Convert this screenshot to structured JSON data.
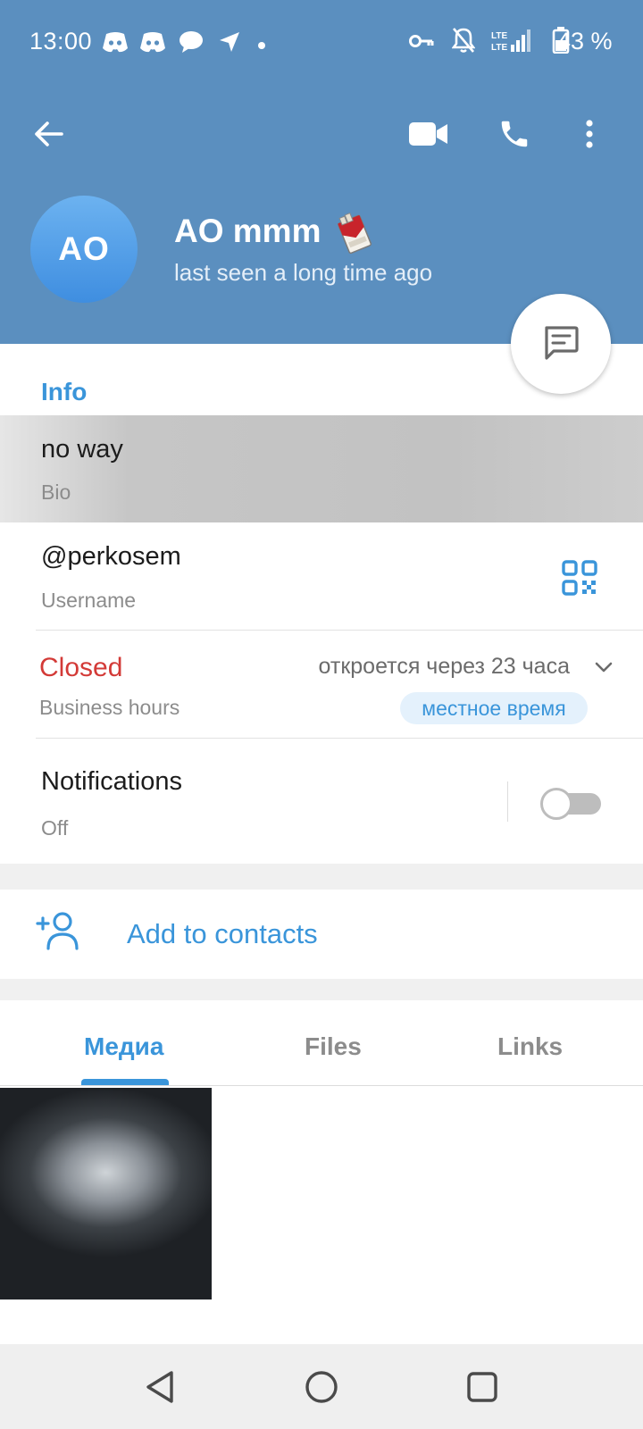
{
  "status_bar": {
    "time": "13:00",
    "battery_text": "43 %",
    "left_icons": [
      "discord-icon",
      "discord-icon",
      "chat-bubble-icon",
      "location-arrow-icon",
      "dot-icon"
    ],
    "right_icons": [
      "vpn-key-icon",
      "mute-icon",
      "lte-signal-icon",
      "battery-icon"
    ]
  },
  "toolbar": {
    "back_icon": "arrow-left-icon",
    "video_icon": "video-call-icon",
    "call_icon": "phone-icon",
    "more_icon": "more-vert-icon"
  },
  "profile": {
    "avatar_initials": "AO",
    "name": "AO mmm",
    "name_emoji": "cigarette-pack-emoji",
    "last_seen": "last seen a long time ago",
    "fab_icon": "message-icon"
  },
  "info": {
    "title": "Info",
    "bio": {
      "value": "no way",
      "label": "Bio"
    },
    "username": {
      "value": "@perkosem",
      "label": "Username",
      "icon": "qr-code-icon"
    },
    "business_hours": {
      "status": "Closed",
      "label": "Business hours",
      "opens_text": "откроется через 23 часа",
      "local_time_badge": "местное время"
    },
    "notifications": {
      "label": "Notifications",
      "value": "Off",
      "enabled": false
    }
  },
  "actions": {
    "add_contacts": {
      "label": "Add to contacts",
      "icon": "add-user-icon"
    }
  },
  "tabs": [
    {
      "label": "Медиа",
      "active": true
    },
    {
      "label": "Files",
      "active": false
    },
    {
      "label": "Links",
      "active": false
    }
  ],
  "colors": {
    "header": "#5b8fbf",
    "accent": "#3a95da",
    "closed": "#d33a37",
    "avatar": "#4a9be6"
  }
}
